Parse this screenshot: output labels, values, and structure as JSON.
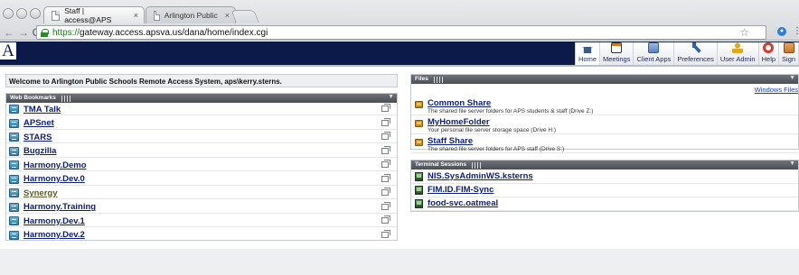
{
  "browser": {
    "tabs": [
      {
        "title": "Staff | access@APS",
        "close": "×",
        "active": true
      },
      {
        "title": "Arlington Public Schools R",
        "close": "×",
        "active": false
      }
    ],
    "url": {
      "scheme": "https://",
      "rest": "gateway.access.apsva.us/dana/home/index.cgi"
    },
    "nav_icons": [
      "back-icon",
      "forward-icon",
      "reload-icon",
      "star-icon",
      "extension-icon",
      "menu-icon"
    ],
    "back_glyph": "←",
    "forward_glyph": "→",
    "reload_glyph": "C",
    "star_glyph": "☆"
  },
  "app": {
    "logo": "A",
    "nav": [
      {
        "label": "Home",
        "icon": "home-icon",
        "color": "#3b5b8a"
      },
      {
        "label": "Meetings",
        "icon": "meeting-icon",
        "color": "#d07a1c"
      },
      {
        "label": "Client Apps",
        "icon": "client-apps-icon",
        "color": "#5a82c0"
      },
      {
        "label": "Preferences",
        "icon": "wrench-icon",
        "color": "#2f5fb0"
      },
      {
        "label": "User Admin",
        "icon": "user-admin-icon",
        "color": "#e0a81a"
      },
      {
        "label": "Help",
        "icon": "lifebuoy-icon",
        "color": "#d23b2f"
      },
      {
        "label": "Sign",
        "icon": "sign-out-icon",
        "color": "#c9762a"
      }
    ]
  },
  "welcome": {
    "text": "Welcome to Arlington Public Schools Remote Access System, aps\\kerry.sterns."
  },
  "bookmarks": {
    "title": "Web Bookmarks",
    "collapse": "▼",
    "items": [
      "TMA Talk",
      "APSnet",
      "STARS",
      "Bugzilla",
      "Harmony.Demo",
      "Harmony.Dev.0",
      "Synergy",
      "Harmony.Training",
      "Harmony.Dev.1",
      "Harmony.Dev.2"
    ]
  },
  "files": {
    "title": "Files",
    "collapse": "▼",
    "windows_link": "Windows Files",
    "items": [
      {
        "name": "Common Share",
        "desc": "The shared file server folders for APS students & staff (Drive Z:)"
      },
      {
        "name": "MyHomeFolder",
        "desc": "Your personal file server storage space (Drive H:)"
      },
      {
        "name": "Staff Share",
        "desc": "The shared file server folders for APS staff (Drive S:)"
      }
    ]
  },
  "terminal": {
    "title": "Terminal Sessions",
    "collapse": "▼",
    "items": [
      "NIS.SysAdminWS.ksterns",
      "FIM.ID.FIM-Sync",
      "food-svc.oatmeal"
    ]
  }
}
